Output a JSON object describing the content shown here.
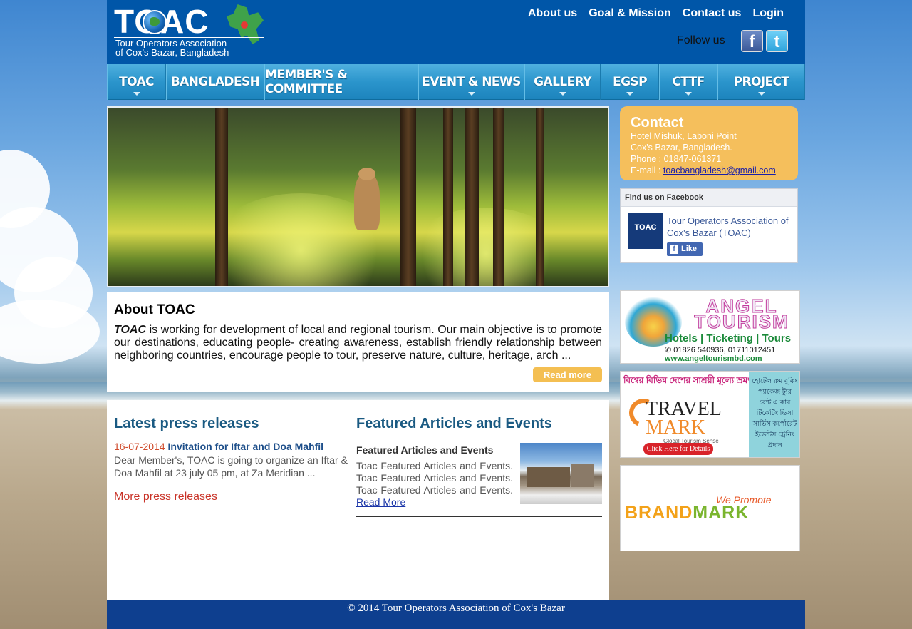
{
  "header": {
    "logo_text": "TOAC",
    "logo_sub1": "Tour Operators Association",
    "logo_sub2": "of Cox's Bazar, Bangladesh",
    "top_links": [
      "About us",
      "Goal & Mission",
      "Contact us",
      "Login"
    ],
    "follow_label": "Follow us",
    "social": [
      "f",
      "t"
    ]
  },
  "nav": {
    "items": [
      {
        "label": "TOAC",
        "dropdown": true
      },
      {
        "label": "BANGLADESH",
        "dropdown": false
      },
      {
        "label": "MEMBER'S & COMMITTEE",
        "dropdown": false
      },
      {
        "label": "EVENT & NEWS",
        "dropdown": true
      },
      {
        "label": "GALLERY",
        "dropdown": true
      },
      {
        "label": "EGSP",
        "dropdown": true
      },
      {
        "label": "CTTF",
        "dropdown": true
      },
      {
        "label": "PROJECT",
        "dropdown": true
      }
    ]
  },
  "about": {
    "title": "About TOAC",
    "lead": "TOAC",
    "text": " is working for development of local and regional tourism. Our main objective is to promote our destinations, educating people- creating awareness, establish friendly relationship between neighboring countries, encourage people to tour, preserve nature, culture, heritage, arch ...",
    "read_more": "Read more"
  },
  "press": {
    "title": "Latest press releases",
    "date": "16-07-2014",
    "item_title": "Invitation for Iftar and Doa Mahfil",
    "item_desc": "Dear Member's, TOAC is going to organize an Iftar & Doa Mahfil at 23 july 05 pm, at Za Meridian ...",
    "more": "More press releases"
  },
  "featured": {
    "title": "Featured Articles and Events",
    "item_title": "Featured Articles and Events",
    "item_desc": "Toac Featured Articles and Events. Toac Featured Articles and Events. Toac Featured Articles and Events.",
    "read_more": "Read More"
  },
  "contact": {
    "title": "Contact",
    "address1": "Hotel Mishuk, Laboni Point",
    "address2": "Cox's Bazar, Bangladesh.",
    "phone": "Phone : 01847-061371",
    "email_label": "E-mail : ",
    "email": "toacbangladesh@gmail.com"
  },
  "facebook": {
    "header": "Find us on Facebook",
    "logo": "TOAC",
    "page_name": "Tour Operators Association of Cox's Bazar (TOAC)",
    "like": "Like"
  },
  "ads": {
    "angel": {
      "title": "ANGEL TOURISM",
      "services": "Hotels | Ticketing | Tours",
      "phone": "✆ 01826 540936, 01711012451",
      "url": "www.angeltourismbd.com"
    },
    "travelmark": {
      "bengali_top": "বিশ্বের বিভিন্ন দেশের সাশ্রয়ী মূল্যে ভ্রমণ করুন",
      "word1": "TRAVEL",
      "word2": "MARK",
      "tagline": "Glocal Tourism Sense",
      "cta": "Click Here for Details",
      "side_text": "হোটেল রুম বুকিং প্যাকেজ ট্যুর রেন্ট এ কার টিকেটিং ভিসা সার্ভিস কর্পোরেট ইভেন্টস ট্রেনিং প্রদান"
    },
    "brandmark": {
      "tagline": "We Promote",
      "word1": "BRAND",
      "word2": "MARK"
    }
  },
  "footer": {
    "text": "© 2014 Tour Operators Association of Cox's Bazar"
  },
  "colors": {
    "header_bg": "#0056a8",
    "nav_bg": "#2b95cc",
    "accent_orange": "#f4bf52",
    "heading_blue": "#1a5a82",
    "footer_bg": "#0e3f8f"
  }
}
